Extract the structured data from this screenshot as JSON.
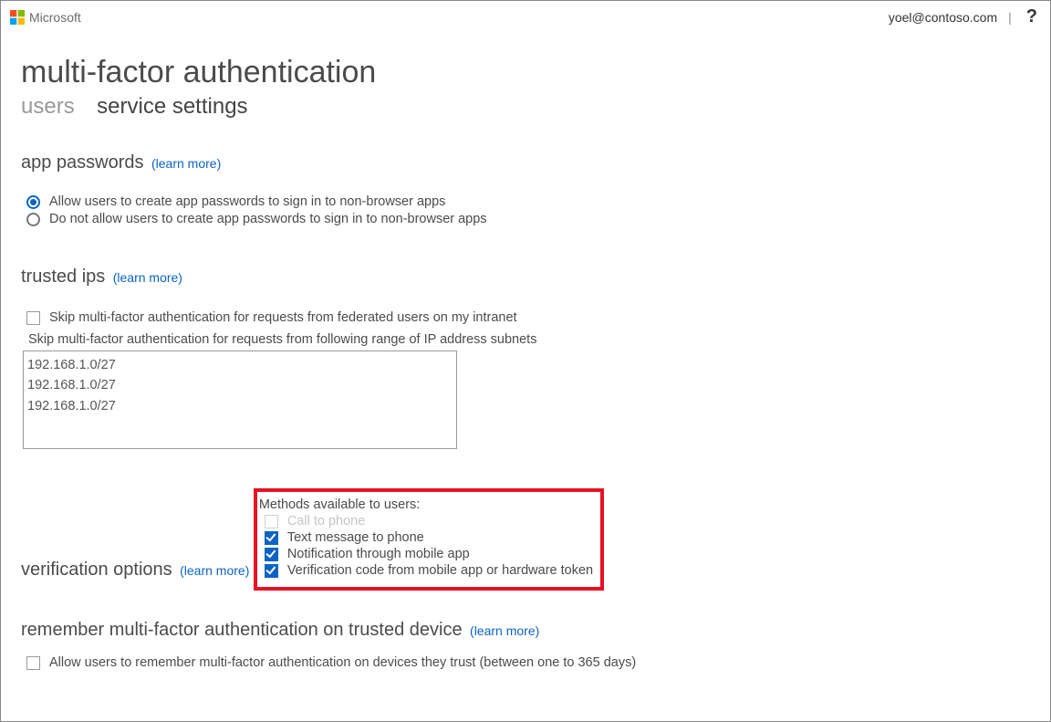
{
  "header": {
    "brand": "Microsoft",
    "user_email": "yoel@contoso.com",
    "divider": "|",
    "help_glyph": "?"
  },
  "page": {
    "title": "multi-factor authentication",
    "tabs": {
      "users": "users",
      "service_settings": "service settings"
    }
  },
  "sections": {
    "app_passwords": {
      "title": "app passwords",
      "learn_more": "(learn more)",
      "options": {
        "allow": "Allow users to create app passwords to sign in to non-browser apps",
        "deny": "Do not allow users to create app passwords to sign in to non-browser apps"
      }
    },
    "trusted_ips": {
      "title": "trusted ips",
      "learn_more": "(learn more)",
      "skip_federated": "Skip multi-factor authentication for requests from federated users on my intranet",
      "skip_range_label": "Skip multi-factor authentication for requests from following range of IP address subnets",
      "ip_value": "192.168.1.0/27\n192.168.1.0/27\n192.168.1.0/27"
    },
    "verification_options": {
      "title": "verification options",
      "learn_more": "(learn more)",
      "methods_label": "Methods available to users:",
      "methods": {
        "call": "Call to phone",
        "text": "Text message to phone",
        "notification": "Notification through mobile app",
        "code": "Verification code from mobile app or hardware token"
      }
    },
    "remember": {
      "title": "remember multi-factor authentication on trusted device",
      "learn_more": "(learn more)",
      "option": "Allow users to remember multi-factor authentication on devices they trust (between one to 365 days)"
    }
  }
}
